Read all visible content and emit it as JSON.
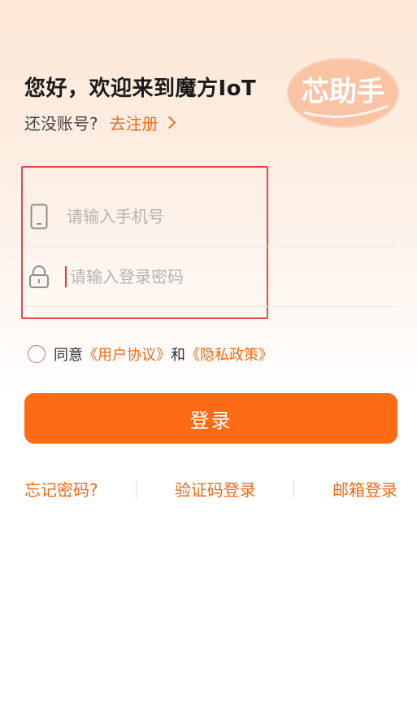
{
  "header": {
    "title": "您好，欢迎来到魔方IoT",
    "no_account": "还没账号?",
    "register": "去注册",
    "badge_text": "芯助手"
  },
  "form": {
    "phone": {
      "placeholder": "请输入手机号",
      "icon": "phone-icon"
    },
    "password": {
      "placeholder": "请输入登录密码",
      "icon": "lock-icon"
    }
  },
  "agreement": {
    "prefix": "同意",
    "user_agreement": "《用户协议》",
    "and": "和",
    "privacy_policy": "《隐私政策》"
  },
  "login_button": "登录",
  "links": {
    "forgot_password": "忘记密码?",
    "code_login": "验证码登录",
    "email_login": "邮箱登录"
  },
  "colors": {
    "accent": "#ff6a14",
    "link": "#ef6a1a",
    "highlight": "#e24a4a"
  }
}
